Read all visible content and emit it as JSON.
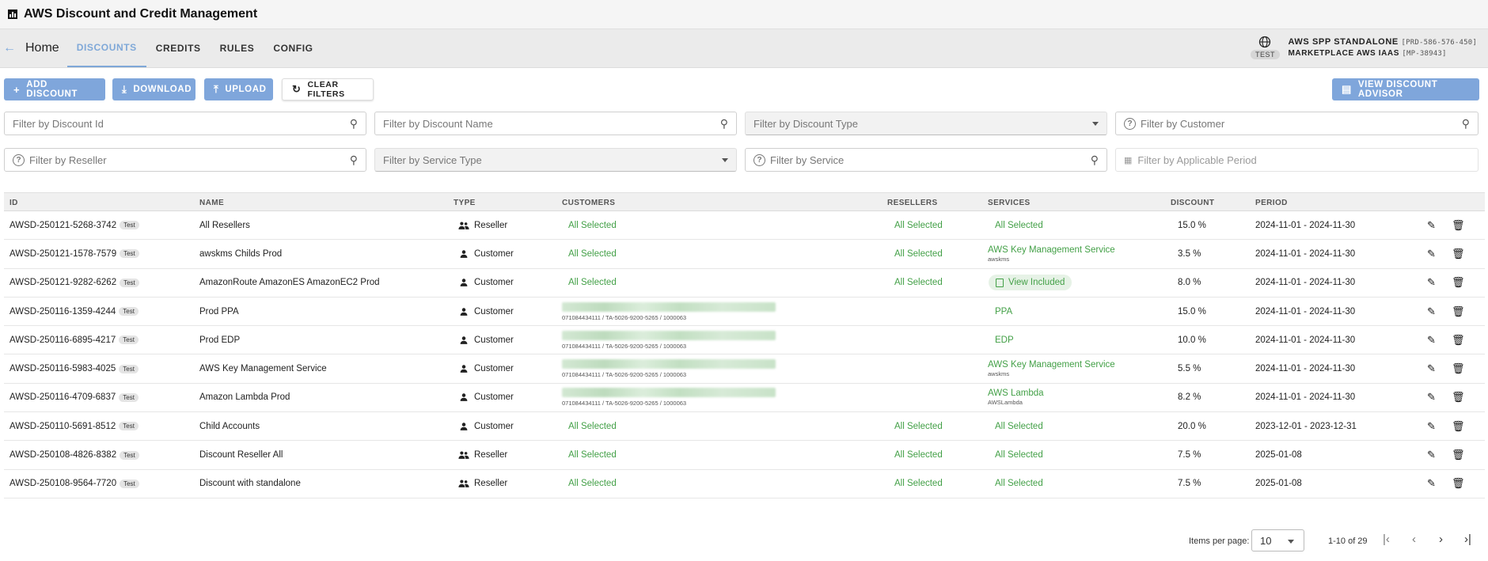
{
  "app": {
    "title": "AWS Discount and Credit Management"
  },
  "nav": {
    "home": "Home",
    "tabs": [
      {
        "label": "DISCOUNTS",
        "active": true
      },
      {
        "label": "CREDITS",
        "active": false
      },
      {
        "label": "RULES",
        "active": false
      },
      {
        "label": "CONFIG",
        "active": false
      }
    ]
  },
  "env": {
    "badge": "TEST",
    "line1": "AWS SPP STANDALONE",
    "line1_code": "[PRD-586-576-450]",
    "line2": "MARKETPLACE AWS IAAS",
    "line2_code": "[MP-38943]"
  },
  "toolbar": {
    "add": "ADD DISCOUNT",
    "download": "DOWNLOAD",
    "upload": "UPLOAD",
    "clear": "CLEAR FILTERS",
    "advisor": "VIEW DISCOUNT ADVISOR"
  },
  "filters": {
    "discount_id": "Filter by Discount Id",
    "discount_name": "Filter by Discount Name",
    "discount_type": "Filter by Discount Type",
    "customer": "Filter by Customer",
    "reseller": "Filter by Reseller",
    "service_type": "Filter by Service Type",
    "service": "Filter by Service",
    "period": "Filter by Applicable Period"
  },
  "table": {
    "columns": [
      "ID",
      "NAME",
      "TYPE",
      "CUSTOMERS",
      "RESELLERS",
      "SERVICES",
      "DISCOUNT",
      "PERIOD"
    ],
    "rows": [
      {
        "id": "AWSD-250121-5268-3742",
        "tag": "Test",
        "name": "All Resellers",
        "type": "Reseller",
        "customers": "All Selected",
        "customers_sub": "",
        "resellers": "All Selected",
        "service": "All Selected",
        "service_sub": "",
        "discount": "15.0 %",
        "period": "2024-11-01 - 2024-11-30"
      },
      {
        "id": "AWSD-250121-1578-7579",
        "tag": "Test",
        "name": "awskms Childs Prod",
        "type": "Customer",
        "customers": "All Selected",
        "customers_sub": "",
        "resellers": "All Selected",
        "service": "AWS Key Management Service",
        "service_sub": "awskms",
        "discount": "3.5 %",
        "period": "2024-11-01 - 2024-11-30"
      },
      {
        "id": "AWSD-250121-9282-6262",
        "tag": "Test",
        "name": "AmazonRoute AmazonES AmazonEC2 Prod",
        "type": "Customer",
        "customers": "All Selected",
        "customers_sub": "",
        "resellers": "All Selected",
        "service": "View Included",
        "service_sub": "",
        "discount": "8.0 %",
        "period": "2024-11-01 - 2024-11-30"
      },
      {
        "id": "AWSD-250116-1359-4244",
        "tag": "Test",
        "name": "Prod PPA",
        "type": "Customer",
        "customers": "",
        "customers_sub": "071084434111 / TA-5026-9200-5265 / 1000063",
        "resellers": "",
        "service": "PPA",
        "service_sub": "",
        "discount": "15.0 %",
        "period": "2024-11-01 - 2024-11-30"
      },
      {
        "id": "AWSD-250116-6895-4217",
        "tag": "Test",
        "name": "Prod EDP",
        "type": "Customer",
        "customers": "",
        "customers_sub": "071084434111 / TA-5026-9200-5265 / 1000063",
        "resellers": "",
        "service": "EDP",
        "service_sub": "",
        "discount": "10.0 %",
        "period": "2024-11-01 - 2024-11-30"
      },
      {
        "id": "AWSD-250116-5983-4025",
        "tag": "Test",
        "name": "AWS Key Management Service",
        "type": "Customer",
        "customers": "",
        "customers_sub": "071084434111 / TA-5026-9200-5265 / 1000063",
        "resellers": "",
        "service": "AWS Key Management Service",
        "service_sub": "awskms",
        "discount": "5.5 %",
        "period": "2024-11-01 - 2024-11-30"
      },
      {
        "id": "AWSD-250116-4709-6837",
        "tag": "Test",
        "name": "Amazon Lambda Prod",
        "type": "Customer",
        "customers": "",
        "customers_sub": "071084434111 / TA-5026-9200-5265 / 1000063",
        "resellers": "",
        "service": "AWS Lambda",
        "service_sub": "AWSLambda",
        "discount": "8.2 %",
        "period": "2024-11-01 - 2024-11-30"
      },
      {
        "id": "AWSD-250110-5691-8512",
        "tag": "Test",
        "name": "Child Accounts",
        "type": "Customer",
        "customers": "All Selected",
        "customers_sub": "",
        "resellers": "All Selected",
        "service": "All Selected",
        "service_sub": "",
        "discount": "20.0 %",
        "period": "2023-12-01 - 2023-12-31"
      },
      {
        "id": "AWSD-250108-4826-8382",
        "tag": "Test",
        "name": "Discount Reseller All",
        "type": "Reseller",
        "customers": "All Selected",
        "customers_sub": "",
        "resellers": "All Selected",
        "service": "All Selected",
        "service_sub": "",
        "discount": "7.5 %",
        "period": "2025-01-08"
      },
      {
        "id": "AWSD-250108-9564-7720",
        "tag": "Test",
        "name": "Discount with standalone",
        "type": "Reseller",
        "customers": "All Selected",
        "customers_sub": "",
        "resellers": "All Selected",
        "service": "All Selected",
        "service_sub": "",
        "discount": "7.5 %",
        "period": "2025-01-08"
      }
    ]
  },
  "pagination": {
    "items_per_page_label": "Items per page:",
    "items_per_page": "10",
    "range": "1-10 of 29"
  },
  "colors": {
    "accent": "#7fa6db",
    "success": "#43a047"
  }
}
